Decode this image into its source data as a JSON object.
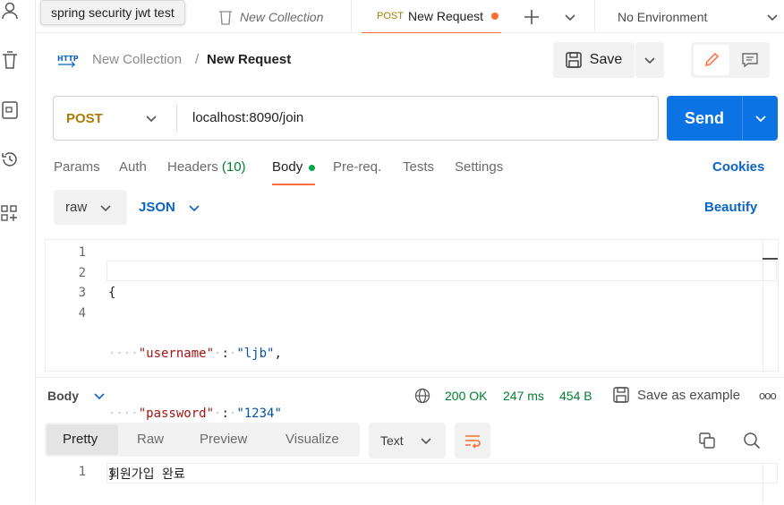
{
  "tooltip": "spring security jwt test",
  "tabs": {
    "collection_tab": "New Collection",
    "request_method": "POST",
    "request_tab": "New Request"
  },
  "environment": "No Environment",
  "breadcrumb": {
    "collection": "New Collection",
    "separator": "/",
    "request": "New Request",
    "http_badge": "HTTP"
  },
  "toolbar": {
    "save_label": "Save"
  },
  "request": {
    "method": "POST",
    "url": "localhost:8090/join",
    "send_label": "Send"
  },
  "request_tabs": {
    "params": "Params",
    "auth": "Auth",
    "headers": "Headers",
    "headers_count": "(10)",
    "body": "Body",
    "prereq": "Pre-req.",
    "tests": "Tests",
    "settings": "Settings",
    "cookies": "Cookies"
  },
  "body_options": {
    "mode": "raw",
    "format": "JSON",
    "beautify": "Beautify"
  },
  "body_editor": {
    "line_numbers": [
      "1",
      "2",
      "3",
      "4"
    ],
    "open_brace": "{",
    "close_brace": "}",
    "key1": "\"username\"",
    "val1": "\"ljb\"",
    "key2": "\"password\"",
    "val2": "\"1234\"",
    "colon": ":",
    "comma": ","
  },
  "response": {
    "label": "Body",
    "status": "200 OK",
    "time": "247 ms",
    "size": "454 B",
    "save_example": "Save as example",
    "more": "ooo",
    "tabs": [
      "Pretty",
      "Raw",
      "Preview",
      "Visualize"
    ],
    "format": "Text",
    "line_number": "1",
    "content": "회원가입 완료"
  },
  "colors": {
    "accent": "#ff6c37",
    "send": "#0b73e4",
    "method_post": "#ad7a03",
    "link": "#0b63c4",
    "status_ok": "#007f31"
  }
}
